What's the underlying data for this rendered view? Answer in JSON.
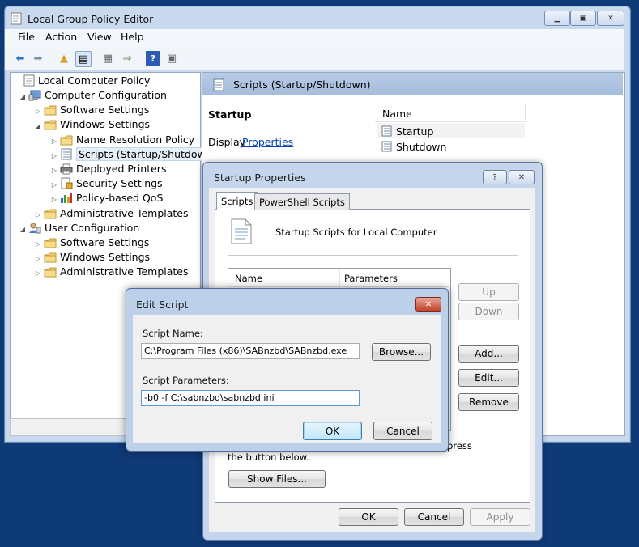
{
  "window": {
    "title": "Local Group Policy Editor"
  },
  "menu": [
    "File",
    "Action",
    "View",
    "Help"
  ],
  "toolbar_icons": [
    "back-icon",
    "forward-icon",
    "up-folder-icon",
    "show-hide-tree-icon",
    "export-list-icon",
    "properties-icon",
    "help-icon",
    "extended-view-icon"
  ],
  "tree": [
    {
      "label": "Local Computer Policy",
      "level": 0,
      "icon": "policy-icon"
    },
    {
      "label": "Computer Configuration",
      "level": 1,
      "icon": "computer-icon",
      "expanded": true
    },
    {
      "label": "Software Settings",
      "level": 2,
      "icon": "folder-icon"
    },
    {
      "label": "Windows Settings",
      "level": 2,
      "icon": "folder-icon",
      "expanded": true
    },
    {
      "label": "Name Resolution Policy",
      "level": 3,
      "icon": "folder-icon"
    },
    {
      "label": "Scripts (Startup/Shutdown)",
      "level": 3,
      "icon": "script-icon",
      "selected": true
    },
    {
      "label": "Deployed Printers",
      "level": 3,
      "icon": "printer-icon"
    },
    {
      "label": "Security Settings",
      "level": 3,
      "icon": "security-icon"
    },
    {
      "label": "Policy-based QoS",
      "level": 3,
      "icon": "chart-icon"
    },
    {
      "label": "Administrative Templates",
      "level": 2,
      "icon": "folder-icon"
    },
    {
      "label": "User Configuration",
      "level": 1,
      "icon": "user-icon",
      "expanded": true
    },
    {
      "label": "Software Settings",
      "level": 2,
      "icon": "folder-icon"
    },
    {
      "label": "Windows Settings",
      "level": 2,
      "icon": "folder-icon"
    },
    {
      "label": "Administrative Templates",
      "level": 2,
      "icon": "folder-icon"
    }
  ],
  "right_pane": {
    "title": "Scripts (Startup/Shutdown)",
    "section": "Startup",
    "display_prefix": "Display",
    "properties_link": "Properties",
    "column_name": "Name",
    "items": [
      "Startup",
      "Shutdown"
    ]
  },
  "startup_dialog": {
    "title": "Startup Properties",
    "help_label": "?",
    "close_label": "✕",
    "tabs": [
      "Scripts",
      "PowerShell Scripts"
    ],
    "heading": "Startup Scripts for Local Computer",
    "columns": [
      "Name",
      "Parameters"
    ],
    "buttons": {
      "up": "Up",
      "down": "Down",
      "add": "Add...",
      "edit": "Edit...",
      "remove": "Remove"
    },
    "hint_tail": "press",
    "hint_line2": "the button below.",
    "show_files": "Show Files...",
    "ok": "OK",
    "cancel": "Cancel",
    "apply": "Apply"
  },
  "edit_dialog": {
    "title": "Edit Script",
    "close_label": "✕",
    "name_label": "Script Name:",
    "name_value": "C:\\Program Files (x86)\\SABnzbd\\SABnzbd.exe",
    "browse": "Browse...",
    "params_label": "Script Parameters:",
    "params_value": "-b0 -f C:\\sabnzbd\\sabnzbd.ini",
    "ok": "OK",
    "cancel": "Cancel"
  }
}
